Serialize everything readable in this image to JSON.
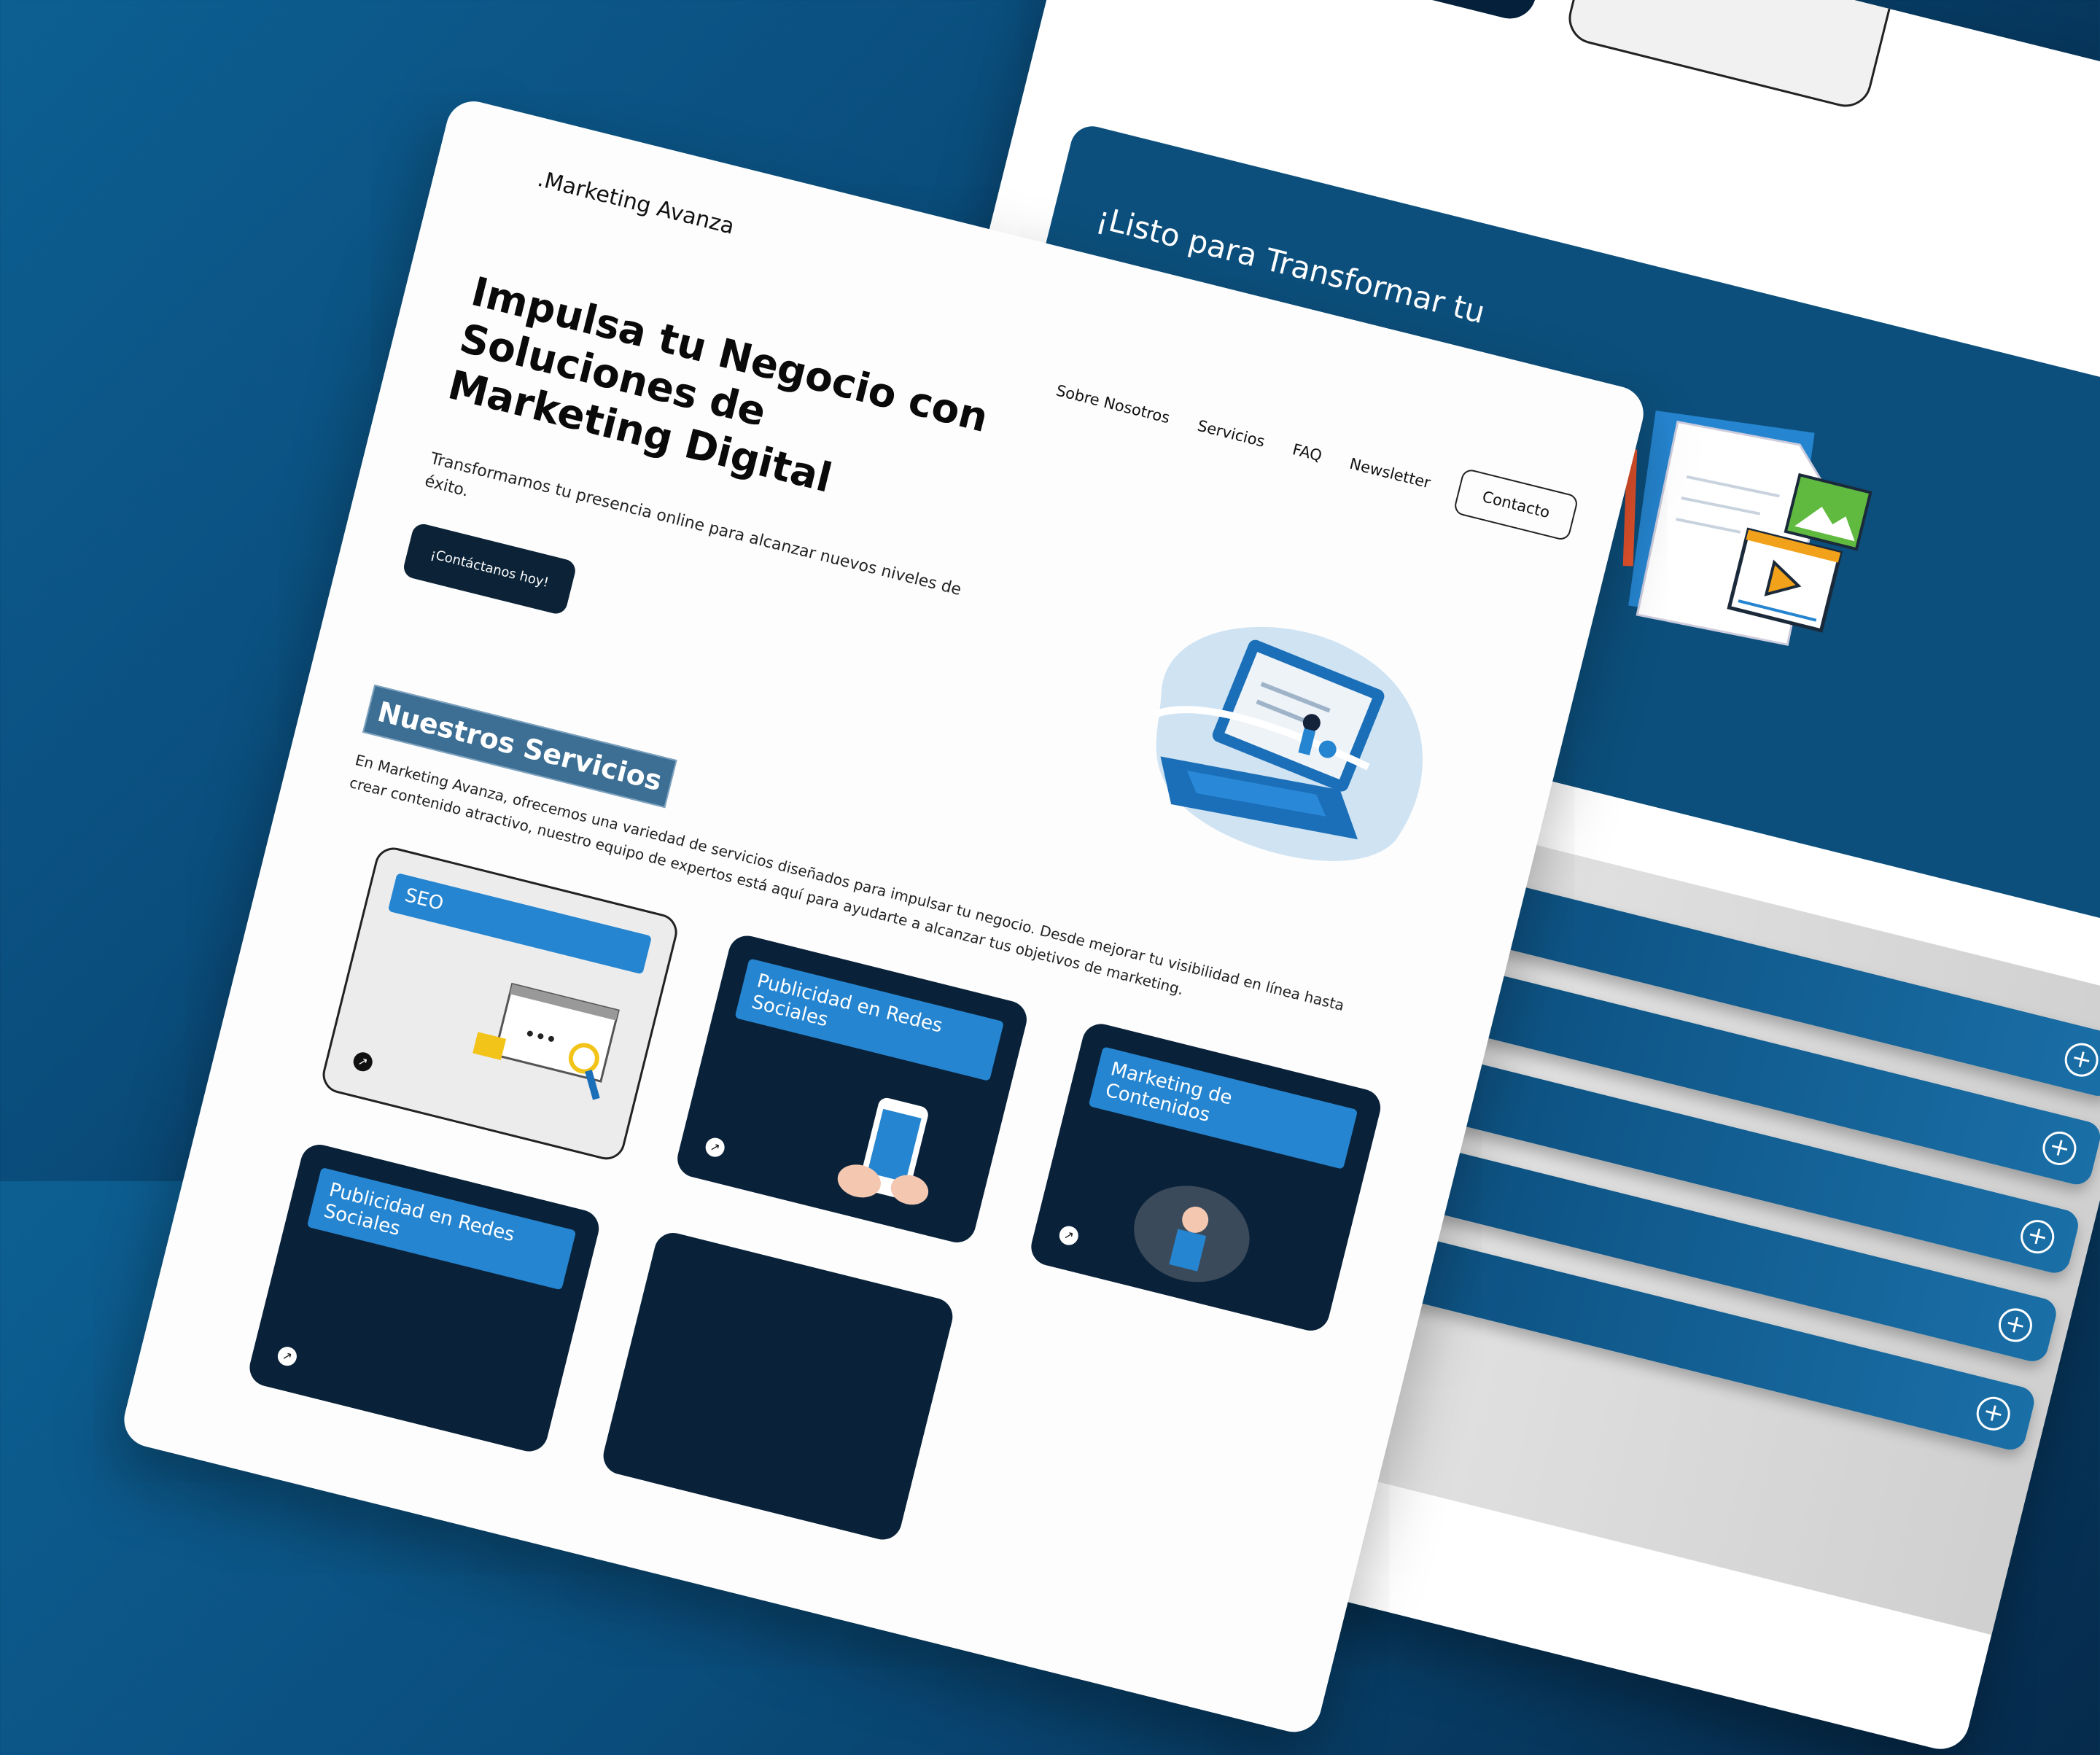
{
  "site": {
    "brand": ".Marketing Avanza",
    "nav": {
      "about": "Sobre Nosotros",
      "services": "Servicios",
      "faq": "FAQ",
      "newsletter": "Newsletter",
      "contact": "Contacto"
    },
    "hero": {
      "title": "Impulsa tu Negocio con Soluciones de Marketing Digital",
      "subtitle": "Transformamos tu presencia online para alcanzar nuevos niveles de éxito.",
      "cta": "¡Contáctanos hoy!"
    },
    "services": {
      "title": "Nuestros Servicios",
      "description": "En Marketing Avanza, ofrecemos una variedad de servicios diseñados para impulsar tu negocio. Desde mejorar tu visibilidad en línea hasta crear contenido atractivo, nuestro equipo de expertos está aquí para ayudarte a alcanzar tus objetivos de marketing.",
      "cards": [
        {
          "label": "SEO"
        },
        {
          "label": "Publicidad en Redes Sociales"
        },
        {
          "label": "Marketing de Contenidos"
        },
        {
          "label": "Publicidad en Redes Sociales"
        }
      ]
    }
  },
  "back_page": {
    "cta_title": "¡Listo para Transformar tu"
  },
  "icons": {
    "card_arrow": "arrow-up-right-icon",
    "faq_toggle": "plus-circle-icon"
  },
  "colors": {
    "background_gradient_start": "#0d5f92",
    "background_gradient_end": "#041f39",
    "accent_blue": "#2685d0",
    "dark_navy": "#0a2239",
    "cta_band": "#0c4f7c",
    "services_title_bg": "#3c6f93"
  }
}
